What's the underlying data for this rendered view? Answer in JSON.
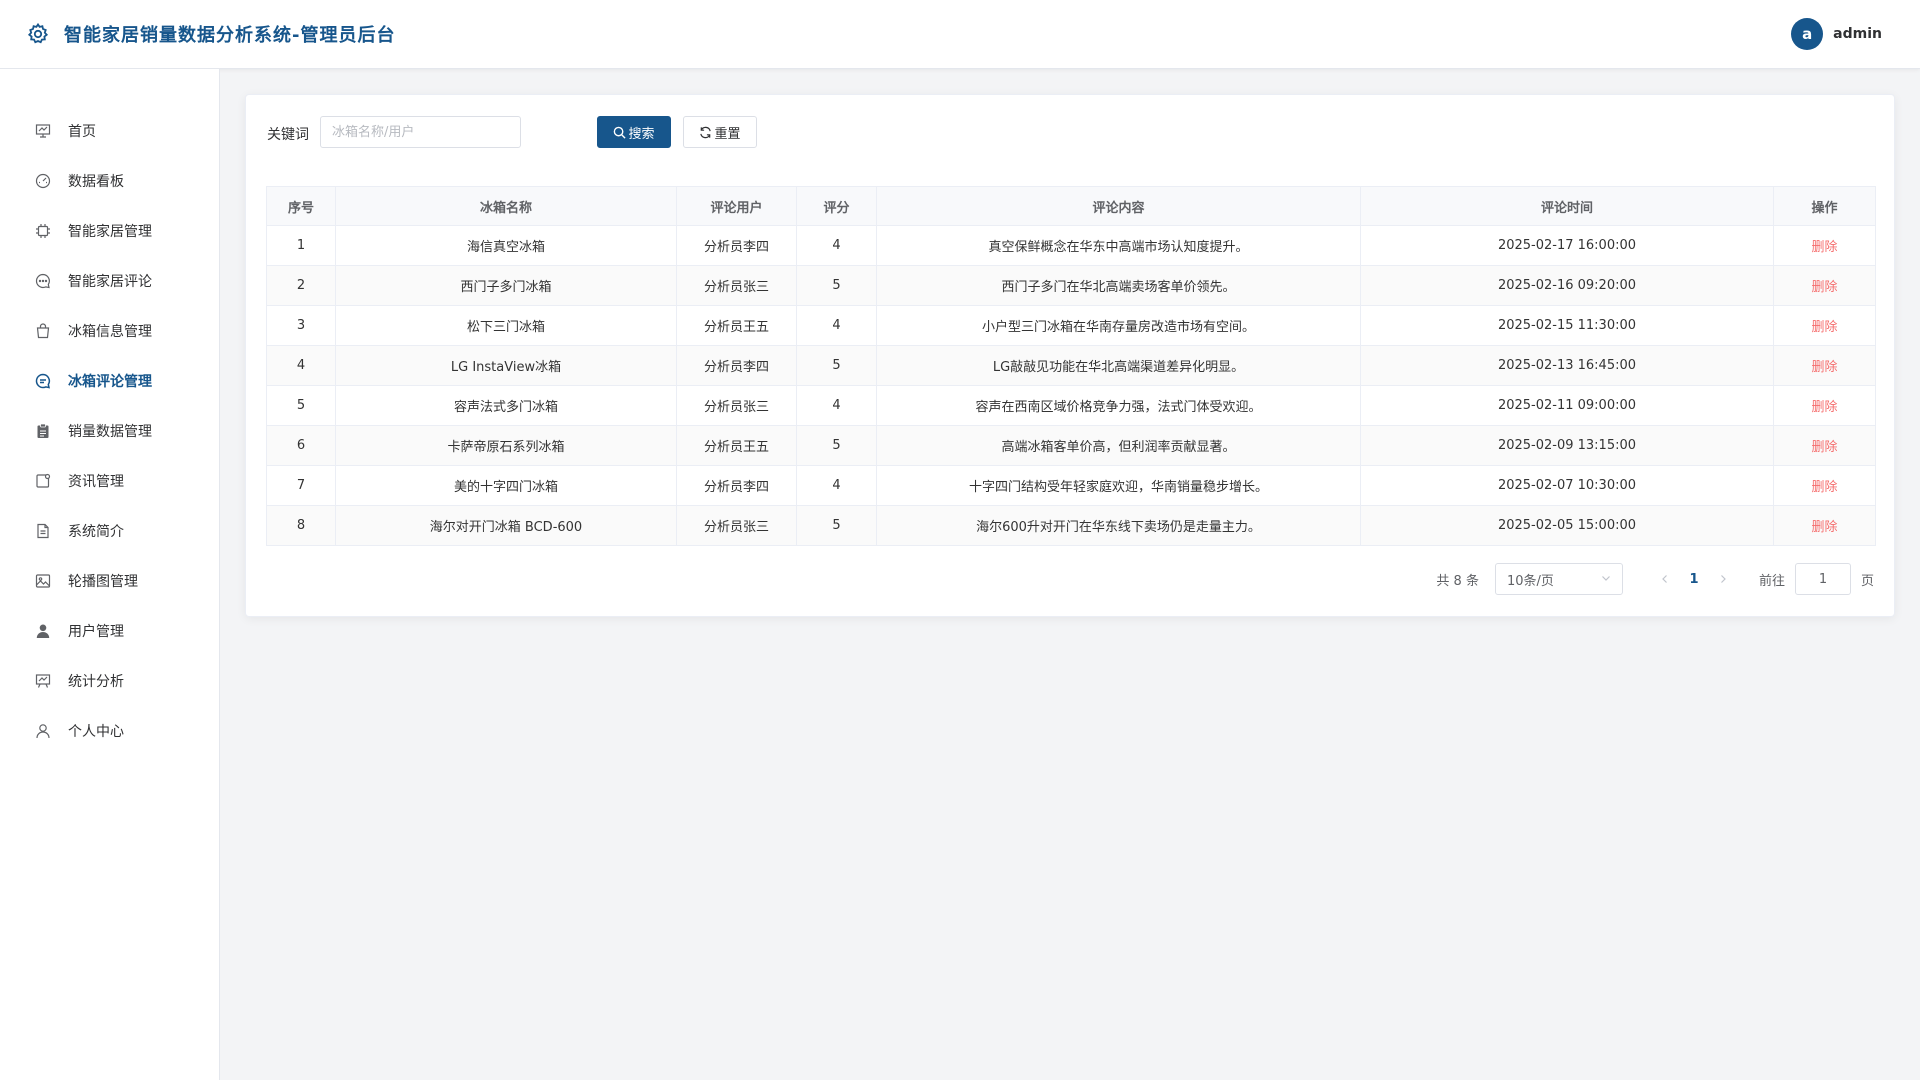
{
  "header": {
    "title": "智能家居销量数据分析系统-管理员后台",
    "avatar_letter": "a",
    "username": "admin"
  },
  "sidebar": {
    "items": [
      {
        "label": "首页",
        "icon": "presentation-icon"
      },
      {
        "label": "数据看板",
        "icon": "dashboard-gauge-icon"
      },
      {
        "label": "智能家居管理",
        "icon": "chip-icon"
      },
      {
        "label": "智能家居评论",
        "icon": "chat-dots-icon"
      },
      {
        "label": "冰箱信息管理",
        "icon": "shopping-bag-icon"
      },
      {
        "label": "冰箱评论管理",
        "icon": "chat-bubble-icon",
        "active": true
      },
      {
        "label": "销量数据管理",
        "icon": "clipboard-icon"
      },
      {
        "label": "资讯管理",
        "icon": "news-icon"
      },
      {
        "label": "系统简介",
        "icon": "document-icon"
      },
      {
        "label": "轮播图管理",
        "icon": "picture-icon"
      },
      {
        "label": "用户管理",
        "icon": "user-filled-icon"
      },
      {
        "label": "统计分析",
        "icon": "chart-board-icon"
      },
      {
        "label": "个人中心",
        "icon": "user-outline-icon"
      }
    ]
  },
  "search": {
    "label": "关键词",
    "placeholder": "冰箱名称/用户",
    "value": "",
    "search_button": "搜索",
    "reset_button": "重置"
  },
  "table": {
    "headers": [
      "序号",
      "冰箱名称",
      "评论用户",
      "评分",
      "评论内容",
      "评论时间",
      "操作"
    ],
    "rows": [
      {
        "index": "1",
        "name": "海信真空冰箱",
        "user": "分析员李四",
        "score": "4",
        "content": "真空保鲜概念在华东中高端市场认知度提升。",
        "time": "2025-02-17 16:00:00",
        "action": "删除"
      },
      {
        "index": "2",
        "name": "西门子多门冰箱",
        "user": "分析员张三",
        "score": "5",
        "content": "西门子多门在华北高端卖场客单价领先。",
        "time": "2025-02-16 09:20:00",
        "action": "删除"
      },
      {
        "index": "3",
        "name": "松下三门冰箱",
        "user": "分析员王五",
        "score": "4",
        "content": "小户型三门冰箱在华南存量房改造市场有空间。",
        "time": "2025-02-15 11:30:00",
        "action": "删除"
      },
      {
        "index": "4",
        "name": "LG InstaView冰箱",
        "user": "分析员李四",
        "score": "5",
        "content": "LG敲敲见功能在华北高端渠道差异化明显。",
        "time": "2025-02-13 16:45:00",
        "action": "删除"
      },
      {
        "index": "5",
        "name": "容声法式多门冰箱",
        "user": "分析员张三",
        "score": "4",
        "content": "容声在西南区域价格竞争力强，法式门体受欢迎。",
        "time": "2025-02-11 09:00:00",
        "action": "删除"
      },
      {
        "index": "6",
        "name": "卡萨帝原石系列冰箱",
        "user": "分析员王五",
        "score": "5",
        "content": "高端冰箱客单价高，但利润率贡献显著。",
        "time": "2025-02-09 13:15:00",
        "action": "删除"
      },
      {
        "index": "7",
        "name": "美的十字四门冰箱",
        "user": "分析员李四",
        "score": "4",
        "content": "十字四门结构受年轻家庭欢迎，华南销量稳步增长。",
        "time": "2025-02-07 10:30:00",
        "action": "删除"
      },
      {
        "index": "8",
        "name": "海尔对开门冰箱 BCD-600",
        "user": "分析员张三",
        "score": "5",
        "content": "海尔600升对开门在华东线下卖场仍是走量主力。",
        "time": "2025-02-05 15:00:00",
        "action": "删除"
      }
    ]
  },
  "pagination": {
    "total_text": "共 8 条",
    "page_size": "10条/页",
    "current_page": "1",
    "goto_label": "前往",
    "goto_value": "1",
    "page_suffix": "页"
  },
  "colors": {
    "brand": "#17568c",
    "danger": "#f56c6c"
  }
}
